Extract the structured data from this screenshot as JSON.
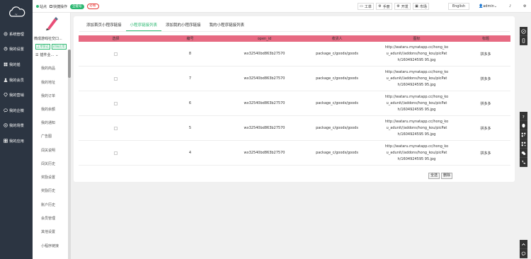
{
  "sidebar": {
    "items": [
      {
        "label": "系统管理",
        "icon": "gear-icon"
      },
      {
        "label": "我的设置",
        "icon": "settings-icon"
      },
      {
        "label": "我的插",
        "icon": "grid-icon"
      },
      {
        "label": "我的会员",
        "icon": "user-icon"
      },
      {
        "label": "我的营销",
        "icon": "diamond-icon"
      },
      {
        "label": "我的企微",
        "icon": "chat-icon"
      },
      {
        "label": "我的场景",
        "icon": "gamepad-icon"
      },
      {
        "label": "我的应用",
        "icon": "apps-icon"
      }
    ]
  },
  "app": {
    "name": "微成游戏社交口...",
    "tags": [
      "正常营运",
      "初始应用"
    ],
    "menu_head": "插件业...",
    "menu": [
      "我的商品",
      "我的地址",
      "我的订单",
      "我的余额",
      "我的通知",
      "广告图",
      "闯关说明",
      "闯关历史",
      "奖励设置",
      "奖励历史",
      "账户历史",
      "会员管理",
      "其他设置",
      "小程序链接"
    ]
  },
  "topbar": {
    "site": "站点",
    "quick_ops": "快捷操作",
    "badge_green": "全能号",
    "badge_red": "必看",
    "buttons": [
      "工单",
      "手册",
      "开发",
      "市场"
    ],
    "language": "English",
    "user": "admin"
  },
  "tabs": [
    "添加首页小程序链接",
    "小程序链接列表",
    "添加我的小程序链接",
    "我的小程序链接列表"
  ],
  "active_tab": 1,
  "table": {
    "headers": [
      "选择",
      "编号",
      "open_id",
      "收货人",
      "图标",
      "标题"
    ],
    "rows": [
      {
        "id": "8",
        "open_id": "wx32540bd863b27570",
        "receiver": "package_c/goods/goods",
        "icon_lines": [
          "http://wataru.mynatapp.cc/hong_ko",
          "u_adunit//addons/hong_kou/picPat",
          "h/1604924595 95.jpg"
        ],
        "title": "拼多多"
      },
      {
        "id": "7",
        "open_id": "wx32540bd863b27570",
        "receiver": "package_c/goods/goods",
        "icon_lines": [
          "http://wataru.mynatapp.cc/hong_ko",
          "u_adunit//addons/hong_kou/picPat",
          "h/1604924595 95.jpg"
        ],
        "title": "拼多多"
      },
      {
        "id": "6",
        "open_id": "wx32540bd863b27570",
        "receiver": "package_c/goods/goods",
        "icon_lines": [
          "http://wataru.mynatapp.cc/hong_ko",
          "u_adunit//addons/hong_kou/picPat",
          "h/1604924595 95.jpg"
        ],
        "title": "拼多多"
      },
      {
        "id": "5",
        "open_id": "wx32540bd863b27570",
        "receiver": "package_c/goods/goods",
        "icon_lines": [
          "http://wataru.mynatapp.cc/hong_ko",
          "u_adunit//addons/hong_kou/picPat",
          "h/1604924595 95.jpg"
        ],
        "title": "拼多多"
      },
      {
        "id": "4",
        "open_id": "wx32540bd863b27570",
        "receiver": "package_c/goods/goods",
        "icon_lines": [
          "http://wataru.mynatapp.cc/hong_ko",
          "u_adunit//addons/hong_kou/picPat",
          "h/1604924595 95.jpg"
        ],
        "title": "拼多多"
      }
    ]
  },
  "footer": {
    "select_all": "全选",
    "delete": "删除"
  },
  "colors": {
    "sidebar_bg": "#2c3542",
    "accent": "#2eb872",
    "table_header": "#e76a82"
  },
  "right_tools": [
    "compass-icon",
    "mobile-icon",
    "question-icon",
    "qq-icon",
    "qrcode-icon",
    "qrcode2-icon",
    "wechat-icon",
    "phone-icon"
  ]
}
